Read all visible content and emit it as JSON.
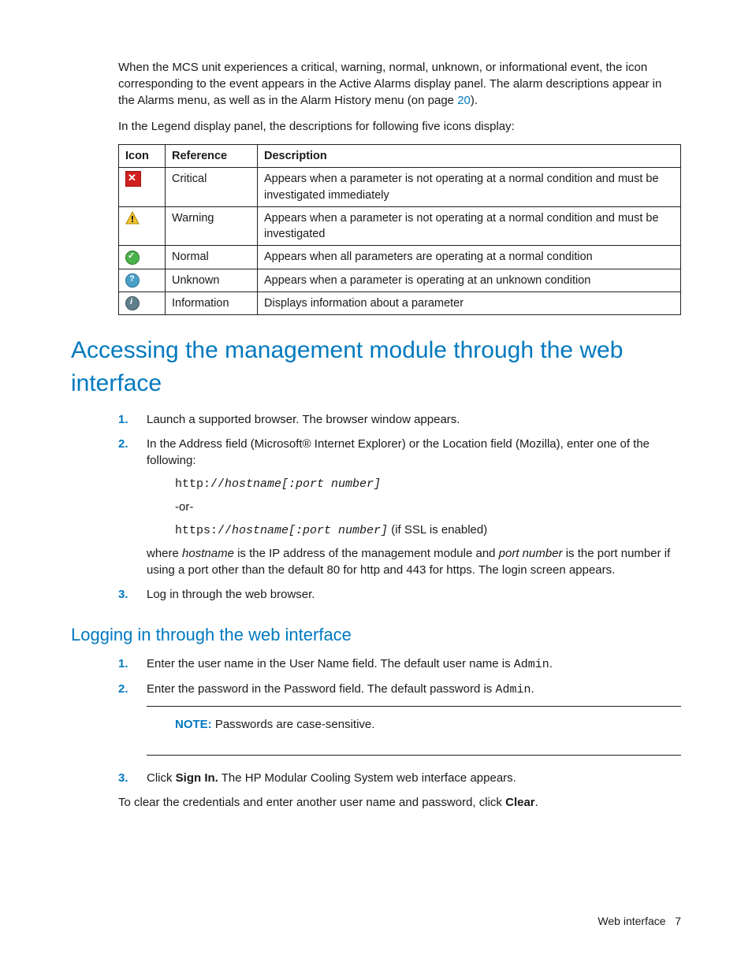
{
  "intro": {
    "p1a": "When the MCS unit experiences a critical, warning, normal, unknown, or informational event, the icon corresponding to the event appears in the Active Alarms display panel. The alarm descriptions appear in the Alarms menu, as well as in the Alarm History menu (on page ",
    "pagelink": "20",
    "p1b": ").",
    "p2": "In the Legend display panel, the descriptions for following five icons display:"
  },
  "table": {
    "h_icon": "Icon",
    "h_ref": "Reference",
    "h_desc": "Description",
    "rows": [
      {
        "icon": "critical",
        "ref": "Critical",
        "desc": "Appears when a parameter is not operating at a normal condition and must be investigated immediately"
      },
      {
        "icon": "warning",
        "ref": "Warning",
        "desc": "Appears when a parameter is not operating at a normal condition and must be investigated"
      },
      {
        "icon": "normal",
        "ref": "Normal",
        "desc": "Appears when all parameters are operating at a normal condition"
      },
      {
        "icon": "unknown",
        "ref": "Unknown",
        "desc": "Appears when a parameter is operating at an unknown condition"
      },
      {
        "icon": "information",
        "ref": "Information",
        "desc": "Displays information about a parameter"
      }
    ]
  },
  "heading1": "Accessing the management module through the web interface",
  "access": {
    "s1": "Launch a supported browser. The browser window appears.",
    "s2": "In the Address field (Microsoft® Internet Explorer) or the Location field (Mozilla), enter one of the following:",
    "s2_url1_pre": "http://",
    "s2_url1_var": "hostname[:port number]",
    "s2_or": "-or-",
    "s2_url2_pre": "https://",
    "s2_url2_var": "hostname[:port number]",
    "s2_url2_suf": " (if SSL is enabled)",
    "s2_where_a": "where ",
    "s2_where_hn": "hostname",
    "s2_where_b": " is the IP address of the management module and ",
    "s2_where_pn": "port number",
    "s2_where_c": " is the port number if using a port other than the default 80 for http and 443 for https. The login screen appears.",
    "s3": "Log in through the web browser."
  },
  "heading2": "Logging in through the web interface",
  "login": {
    "s1a": "Enter the user name in the User Name field. The default user name is ",
    "s1b": "Admin",
    "s1c": ".",
    "s2a": "Enter the password in the Password field. The default password is ",
    "s2b": "Admin",
    "s2c": ".",
    "note_label": "NOTE:",
    "note_text": "   Passwords are case-sensitive.",
    "s3a": "Click ",
    "s3b": "Sign In.",
    "s3c": " The HP Modular Cooling System web interface appears.",
    "clear_a": "To clear the credentials and enter another user name and password, click ",
    "clear_b": "Clear",
    "clear_c": "."
  },
  "footer": {
    "title": "Web interface",
    "page": "7"
  }
}
